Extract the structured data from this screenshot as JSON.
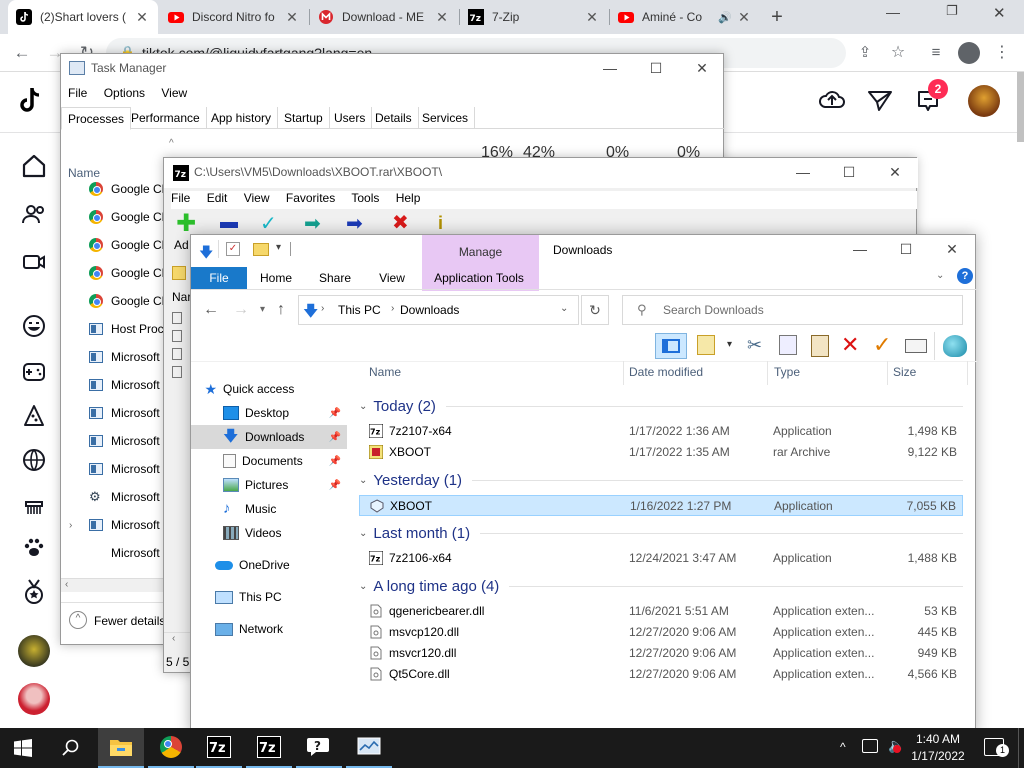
{
  "browser": {
    "tabs": [
      {
        "title": "(2)Shart lovers (",
        "favicon": "tiktok-icon"
      },
      {
        "title": "Discord Nitro fo",
        "favicon": "youtube-icon"
      },
      {
        "title": "Download - ME",
        "favicon": "mega-icon"
      },
      {
        "title": "7-Zip",
        "favicon": "7zip-icon"
      },
      {
        "title": "Aminé - Co",
        "favicon": "youtube-icon"
      }
    ],
    "url": "tiktok.com/@liquidyfartgang?lang=en",
    "new_tab": "+",
    "notification_count": "2"
  },
  "task_manager": {
    "title": "Task Manager",
    "menu": [
      "File",
      "Options",
      "View"
    ],
    "tabs": [
      "Processes",
      "Performance",
      "App history",
      "Startup",
      "Users",
      "Details",
      "Services"
    ],
    "col_name": "Name",
    "percents": [
      "16%",
      "42%",
      "0%",
      "0%"
    ],
    "processes": [
      {
        "name": "Google Ch",
        "icon": "chrome-icon"
      },
      {
        "name": "Google Ch",
        "icon": "chrome-icon"
      },
      {
        "name": "Google Ch",
        "icon": "chrome-icon"
      },
      {
        "name": "Google Ch",
        "icon": "chrome-icon"
      },
      {
        "name": "Google Ch",
        "icon": "chrome-icon"
      },
      {
        "name": "Host Proc",
        "icon": "window-icon"
      },
      {
        "name": "Microsoft",
        "icon": "window-icon"
      },
      {
        "name": "Microsoft",
        "icon": "window-icon"
      },
      {
        "name": "Microsoft",
        "icon": "window-icon"
      },
      {
        "name": "Microsoft",
        "icon": "window-icon"
      },
      {
        "name": "Microsoft",
        "icon": "window-icon"
      },
      {
        "name": "Microsoft",
        "icon": "gear-icon"
      },
      {
        "name": "Microsoft",
        "icon": "window-icon"
      },
      {
        "name": "Microsoft",
        "icon": "none"
      }
    ],
    "fewer_details": "Fewer details"
  },
  "sevenzip": {
    "title": "C:\\Users\\VM5\\Downloads\\XBOOT.rar\\XBOOT\\",
    "menu": [
      "File",
      "Edit",
      "View",
      "Favorites",
      "Tools",
      "Help"
    ],
    "left_label": "Ad",
    "col_name": "Nar",
    "status": "5 / 5"
  },
  "explorer": {
    "title": "Downloads",
    "manage": "Manage",
    "ribbon_tabs": [
      "File",
      "Home",
      "Share",
      "View",
      "Application Tools"
    ],
    "breadcrumb": [
      "This PC",
      "Downloads"
    ],
    "search_placeholder": "Search Downloads",
    "columns": [
      "Name",
      "Date modified",
      "Type",
      "Size"
    ],
    "nav": [
      {
        "label": "Quick access",
        "icon": "star-icon"
      },
      {
        "label": "Desktop",
        "icon": "desktop-icon",
        "pinned": true
      },
      {
        "label": "Downloads",
        "icon": "download-icon",
        "pinned": true,
        "selected": true
      },
      {
        "label": "Documents",
        "icon": "documents-icon",
        "pinned": true
      },
      {
        "label": "Pictures",
        "icon": "pictures-icon",
        "pinned": true
      },
      {
        "label": "Music",
        "icon": "music-icon"
      },
      {
        "label": "Videos",
        "icon": "videos-icon"
      },
      {
        "label": "OneDrive",
        "icon": "cloud-icon"
      },
      {
        "label": "This PC",
        "icon": "computer-icon"
      },
      {
        "label": "Network",
        "icon": "network-icon"
      }
    ],
    "groups": [
      {
        "label": "Today (2)",
        "files": [
          {
            "name": "7z2107-x64",
            "date": "1/17/2022 1:36 AM",
            "type": "Application",
            "size": "1,498 KB",
            "icon": "7zip-icon"
          },
          {
            "name": "XBOOT",
            "date": "1/17/2022 1:35 AM",
            "type": "rar Archive",
            "size": "9,122 KB",
            "icon": "archive-icon"
          }
        ]
      },
      {
        "label": "Yesterday (1)",
        "files": [
          {
            "name": "XBOOT",
            "date": "1/16/2022 1:27 PM",
            "type": "Application",
            "size": "7,055 KB",
            "icon": "xboot-icon",
            "selected": true
          }
        ]
      },
      {
        "label": "Last month (1)",
        "files": [
          {
            "name": "7z2106-x64",
            "date": "12/24/2021 3:47 AM",
            "type": "Application",
            "size": "1,488 KB",
            "icon": "7zip-icon"
          }
        ]
      },
      {
        "label": "A long time ago (4)",
        "files": [
          {
            "name": "qgenericbearer.dll",
            "date": "11/6/2021 5:51 AM",
            "type": "Application exten...",
            "size": "53 KB",
            "icon": "dll-icon"
          },
          {
            "name": "msvcp120.dll",
            "date": "12/27/2020 9:06 AM",
            "type": "Application exten...",
            "size": "445 KB",
            "icon": "dll-icon"
          },
          {
            "name": "msvcr120.dll",
            "date": "12/27/2020 9:06 AM",
            "type": "Application exten...",
            "size": "949 KB",
            "icon": "dll-icon"
          },
          {
            "name": "Qt5Core.dll",
            "date": "12/27/2020 9:06 AM",
            "type": "Application exten...",
            "size": "4,566 KB",
            "icon": "dll-icon"
          }
        ]
      }
    ]
  },
  "taskbar": {
    "time": "1:40 AM",
    "date": "1/17/2022",
    "notifications": "1",
    "apps": [
      "file-explorer-icon",
      "chrome-icon",
      "7zip-icon",
      "7zip-icon",
      "help-icon",
      "task-manager-icon"
    ]
  },
  "colors": {
    "accent": "#0063b1",
    "selection": "#cce8ff",
    "manage": "#e8c8f4",
    "tiktok_badge": "#fe2c55",
    "taskbar": "#1a1a1a"
  }
}
